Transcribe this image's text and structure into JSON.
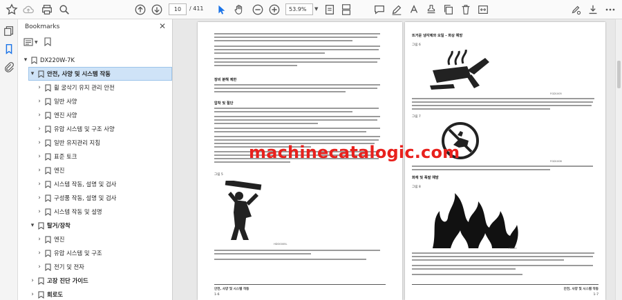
{
  "toolbar": {
    "page_current": "10",
    "page_total": "/ 411",
    "zoom": "53.9%"
  },
  "bookmarks_panel": {
    "title": "Bookmarks",
    "root": "DX220W-7K",
    "items": [
      {
        "label": "안전, 사양 및 시스템 작동",
        "level": 1,
        "expanded": true,
        "bold": true
      },
      {
        "label": "휠 굴삭기 유지 관리 안전",
        "level": 2,
        "expanded": false
      },
      {
        "label": "일반 사양",
        "level": 2,
        "expanded": false
      },
      {
        "label": "엔진 사양",
        "level": 2,
        "expanded": false
      },
      {
        "label": "유압 시스템 및 구조 사양",
        "level": 2,
        "expanded": false
      },
      {
        "label": "일반 유지관리 지침",
        "level": 2,
        "expanded": false
      },
      {
        "label": "표준 토크",
        "level": 2,
        "expanded": false
      },
      {
        "label": "엔진",
        "level": 2,
        "expanded": false
      },
      {
        "label": "시스템 작동, 설명 및 검사",
        "level": 2,
        "expanded": false
      },
      {
        "label": "구성품 작동, 설명 및 검사",
        "level": 2,
        "expanded": false
      },
      {
        "label": "시스템 작동 및 설명",
        "level": 2,
        "expanded": false
      },
      {
        "label": "탈거/장착",
        "level": 1,
        "expanded": true,
        "bold": true
      },
      {
        "label": "엔진",
        "level": 2,
        "expanded": false
      },
      {
        "label": "유압 시스템 및 구조",
        "level": 2,
        "expanded": false
      },
      {
        "label": "전기 및 전자",
        "level": 2,
        "expanded": false
      },
      {
        "label": "고장 진단 가이드",
        "level": 1,
        "expanded": false,
        "bold": true
      },
      {
        "label": "회로도",
        "level": 1,
        "expanded": false,
        "bold": true
      }
    ]
  },
  "document": {
    "left_page": {
      "heading_1": "장비 분해 제한",
      "heading_2": "압착 및 절단",
      "figure_label": "그림 5",
      "figure_code": "HDO0005L",
      "footer_title": "안전, 사양 및 시스템 작동",
      "footer_page": "1-6"
    },
    "right_page": {
      "heading_1": "뜨거운 냉각제와 오일 - 화상 예방",
      "figure_6_label": "그림 6",
      "figure_6_code": "FGD1005",
      "figure_7_label": "그림 7",
      "figure_7_code": "FGD1008",
      "heading_2": "화재 및 폭발 예방",
      "figure_8_label": "그림 8",
      "figure_8_code": "H0011",
      "footer_title": "안전, 사양 및 시스템 작동",
      "footer_page": "1-7"
    },
    "watermark": "machinecatalogic.com"
  },
  "colors": {
    "watermark": "#e8211d",
    "selection": "#cfe3f7",
    "accent_blue": "#1a73e8"
  }
}
